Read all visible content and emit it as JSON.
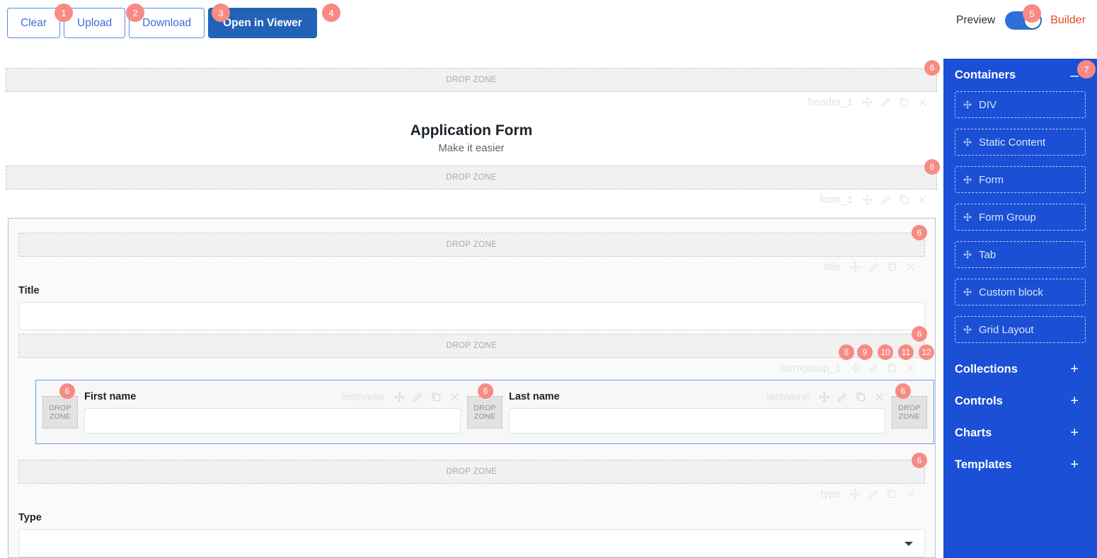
{
  "toolbar": {
    "buttons": [
      {
        "label": "Clear",
        "name": "clear-button",
        "badge": "1"
      },
      {
        "label": "Upload",
        "name": "upload-button",
        "badge": "2"
      },
      {
        "label": "Download",
        "name": "download-button",
        "badge": "3"
      },
      {
        "label": "Open in Viewer",
        "name": "open-in-viewer-button",
        "badge": "4"
      }
    ],
    "toggle": {
      "left_label": "Preview",
      "right_label": "Builder",
      "badge": "5",
      "state": "builder",
      "on_color": "#2f6fd8"
    }
  },
  "canvas": {
    "drop_zone_label": "DROP ZONE",
    "drop_zone_badge": "6",
    "header": {
      "title": "Application Form",
      "subtitle": "Make it easier",
      "control_name": "header_1"
    },
    "form": {
      "control_name": "form_1"
    },
    "fields": [
      {
        "label": "Title",
        "control_name": "title",
        "type": "text",
        "value": ""
      },
      {
        "label": "Type",
        "control_name": "type",
        "type": "select",
        "value": ""
      }
    ],
    "formgroup": {
      "control_name": "formgroup_1",
      "badges": [
        "8",
        "9",
        "10",
        "11",
        "12"
      ],
      "columns": [
        {
          "label": "First name",
          "control_name": "firstname",
          "value": ""
        },
        {
          "label": "Last name",
          "control_name": "lastname",
          "value": ""
        }
      ]
    },
    "control_icons": [
      "move-icon",
      "edit-icon",
      "duplicate-icon",
      "close-icon"
    ]
  },
  "sidebar": {
    "background": "#1a4fd6",
    "badge": "7",
    "sections": [
      {
        "title": "Containers",
        "state": "expanded",
        "sign": "–"
      },
      {
        "title": "Collections",
        "state": "collapsed",
        "sign": "+"
      },
      {
        "title": "Controls",
        "state": "collapsed",
        "sign": "+"
      },
      {
        "title": "Charts",
        "state": "collapsed",
        "sign": "+"
      },
      {
        "title": "Templates",
        "state": "collapsed",
        "sign": "+"
      }
    ],
    "items": [
      {
        "label": "DIV"
      },
      {
        "label": "Static Content"
      },
      {
        "label": "Form"
      },
      {
        "label": "Form Group"
      },
      {
        "label": "Tab"
      },
      {
        "label": "Custom block"
      },
      {
        "label": "Grid Layout"
      }
    ]
  }
}
